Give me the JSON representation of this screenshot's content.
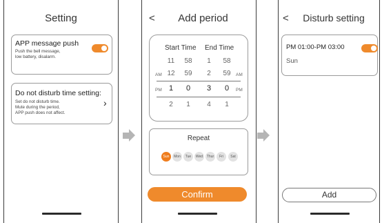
{
  "screen1": {
    "title": "Setting",
    "push_title": "APP message push",
    "push_desc": [
      "Push the bell message,",
      "low battery, disalarm."
    ],
    "dnd_title": "Do not disturb time setting:",
    "dnd_desc": [
      "Set do not disturb time.",
      "Mute during the period,",
      "APP push does not affect."
    ]
  },
  "screen2": {
    "back": "<",
    "title": "Add period",
    "start_label": "Start Time",
    "end_label": "End Time",
    "rows": [
      {
        "ampm_left": "",
        "h1": "11",
        "m1": "58",
        "h2": "1",
        "m2": "58",
        "ampm_right": ""
      },
      {
        "ampm_left": "AM",
        "h1": "12",
        "m1": "59",
        "h2": "2",
        "m2": "59",
        "ampm_right": "AM"
      },
      {
        "ampm_left": "PM",
        "h1": "1",
        "m1": "0",
        "h2": "3",
        "m2": "0",
        "ampm_right": "PM"
      },
      {
        "ampm_left": "",
        "h1": "2",
        "m1": "1",
        "h2": "4",
        "m2": "1",
        "ampm_right": ""
      }
    ],
    "repeat_label": "Repeat",
    "days": [
      "Sun",
      "Mon",
      "Tue",
      "Wed",
      "Thur",
      "Fri",
      "Sat"
    ],
    "selected_day": "Sun",
    "confirm_label": "Confirm"
  },
  "screen3": {
    "back": "<",
    "title": "Disturb setting",
    "period": "PM 01:00-PM 03:00",
    "period_days": "Sun",
    "add_label": "Add"
  },
  "colors": {
    "accent": "#ef8a2c",
    "day_inactive": "#e2e2e2"
  }
}
